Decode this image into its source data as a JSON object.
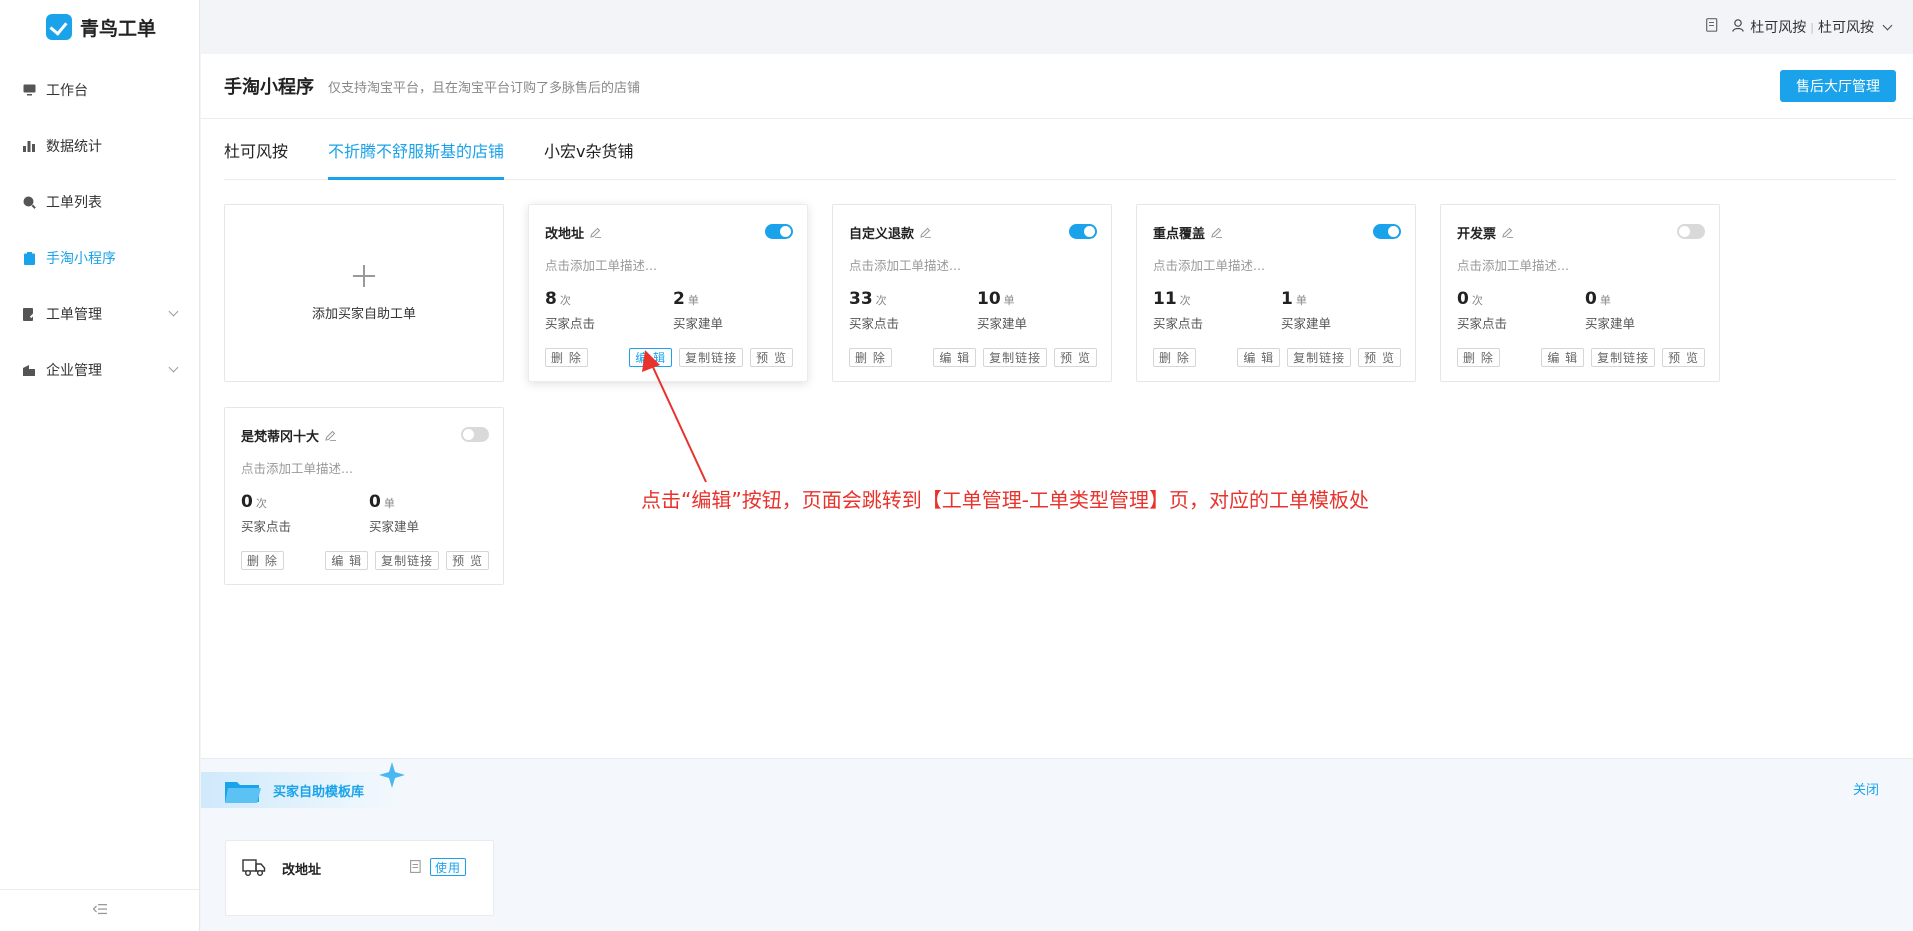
{
  "app": {
    "name": "青鸟工单",
    "brand_color": "#1aa3ea"
  },
  "sidebar": {
    "items": [
      {
        "label": "工作台",
        "icon": "monitor-icon"
      },
      {
        "label": "数据统计",
        "icon": "bar-chart-icon"
      },
      {
        "label": "工单列表",
        "icon": "search-icon"
      },
      {
        "label": "手淘小程序",
        "icon": "clipboard-icon",
        "active": true
      },
      {
        "label": "工单管理",
        "icon": "doc-edit-icon",
        "expandable": true
      },
      {
        "label": "企业管理",
        "icon": "building-icon",
        "expandable": true
      }
    ],
    "collapse_icon": "collapse-icon"
  },
  "topbar": {
    "user": "杜可风按",
    "separator": "|",
    "account": "杜可风按"
  },
  "page": {
    "title": "手淘小程序",
    "subtitle": "仅支持淘宝平台，且在淘宝平台订购了多脉售后的店铺",
    "hall_button": "售后大厅管理"
  },
  "tabs": [
    {
      "label": "杜可风按"
    },
    {
      "label": "不折腾不舒服斯基的店铺",
      "active": true
    },
    {
      "label": "小宏v杂货铺"
    }
  ],
  "add_card": {
    "label": "添加买家自助工单"
  },
  "card_labels": {
    "desc_placeholder": "点击添加工单描述...",
    "clicks_unit": "次",
    "orders_unit": "单",
    "clicks_label": "买家点击",
    "orders_label": "买家建单",
    "delete": "删 除",
    "edit": "编 辑",
    "copy_link": "复制链接",
    "preview": "预 览"
  },
  "cards": [
    {
      "title": "改地址",
      "enabled": true,
      "clicks": "8",
      "orders": "2"
    },
    {
      "title": "自定义退款",
      "enabled": true,
      "clicks": "33",
      "orders": "10"
    },
    {
      "title": "重点覆盖",
      "enabled": true,
      "clicks": "11",
      "orders": "1"
    },
    {
      "title": "开发票",
      "enabled": false,
      "clicks": "0",
      "orders": "0"
    },
    {
      "title": "是梵蒂冈十大",
      "enabled": false,
      "clicks": "0",
      "orders": "0"
    }
  ],
  "annotation": {
    "text": "点击“编辑”按钮，页面会跳转到【工单管理-工单类型管理】页，对应的工单模板处",
    "color": "#e8332d"
  },
  "library": {
    "title": "买家自助模板库",
    "close": "关闭",
    "templates": [
      {
        "name": "改地址",
        "use": "使用",
        "icon": "truck-icon"
      }
    ]
  }
}
